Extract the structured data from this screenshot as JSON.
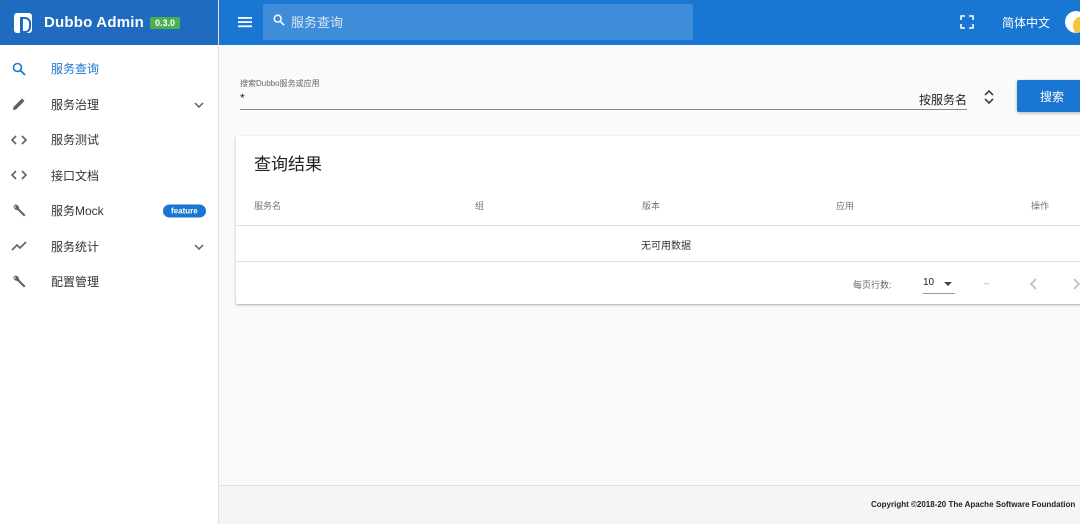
{
  "brand": {
    "title": "Dubbo Admin",
    "version": "0.3.0"
  },
  "topbar": {
    "search_placeholder": "服务查询",
    "language": "简体中文"
  },
  "sidebar": {
    "items": [
      {
        "label": "服务查询",
        "icon": "search-icon",
        "active": true
      },
      {
        "label": "服务治理",
        "icon": "pencil-icon",
        "expandable": true
      },
      {
        "label": "服务测试",
        "icon": "code-icon"
      },
      {
        "label": "接口文档",
        "icon": "code-icon"
      },
      {
        "label": "服务Mock",
        "icon": "wrench-icon",
        "badge": "feature"
      },
      {
        "label": "服务统计",
        "icon": "trending-icon",
        "expandable": true
      },
      {
        "label": "配置管理",
        "icon": "wrench-icon"
      }
    ]
  },
  "search_form": {
    "label": "搜索Dubbo服务或应用",
    "value": "*",
    "select_value": "按服务名",
    "button": "搜索"
  },
  "results": {
    "title": "查询结果",
    "columns": [
      "服务名",
      "组",
      "版本",
      "应用",
      "操作"
    ],
    "empty_text": "无可用数据",
    "rows_per_page_label": "每页行数:",
    "rows_per_page_value": "10",
    "range_text": "–"
  },
  "footer": {
    "text": "Copyright ©2018-20 The Apache Software Foundation"
  },
  "colors": {
    "primary": "#1976d2",
    "brand_bar": "#1e6bc0",
    "version_badge": "#4caf50"
  }
}
